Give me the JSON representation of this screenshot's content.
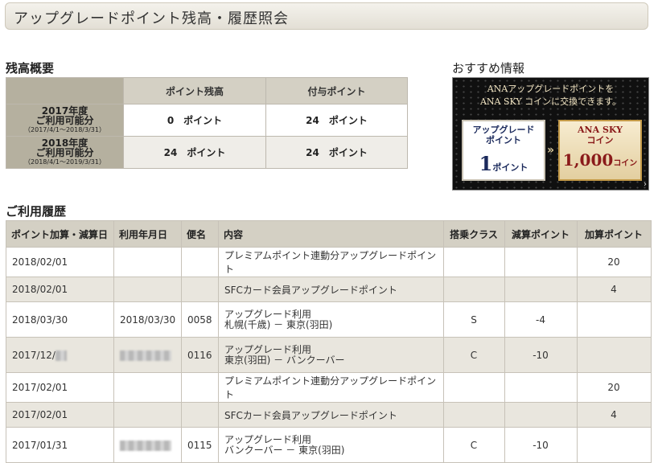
{
  "page": {
    "title": "アップグレードポイント残高・履歴照会"
  },
  "summary": {
    "heading": "残高概要",
    "columns": [
      "ポイント残高",
      "付与ポイント"
    ],
    "rows": [
      {
        "label": "2017年度",
        "label2": "ご利用可能分",
        "period": "（2017/4/1～2018/3/31）",
        "balance": "0　ポイント",
        "granted": "24　ポイント"
      },
      {
        "label": "2018年度",
        "label2": "ご利用可能分",
        "period": "（2018/4/1～2019/3/31）",
        "balance": "24　ポイント",
        "granted": "24　ポイント"
      }
    ]
  },
  "recommend": {
    "heading": "おすすめ情報",
    "banner_line1": "ANAアップグレードポイントを",
    "banner_line2": "ANA SKY コインに交換できます。",
    "from_title1": "アップグレード",
    "from_title2": "ポイント",
    "from_value": "1",
    "from_unit": "ポイント",
    "to_title1": "ANA SKY",
    "to_title2": "コイン",
    "to_value": "1,000",
    "to_unit": "コイン",
    "arrow_glyph": "»",
    "corner_arrow": "›"
  },
  "history": {
    "heading": "ご利用履歴",
    "columns": [
      "ポイント加算・減算日",
      "利用年月日",
      "便名",
      "内容",
      "搭乗クラス",
      "減算ポイント",
      "加算ポイント"
    ],
    "rows": [
      {
        "date": "2018/02/01",
        "use_date": "",
        "flight": "",
        "content": "プレミアムポイント連動分アップグレードポイント",
        "content2": "",
        "class": "",
        "minus": "",
        "plus": "20"
      },
      {
        "date": "2018/02/01",
        "use_date": "",
        "flight": "",
        "content": "SFCカード会員アップグレードポイント",
        "content2": "",
        "class": "",
        "minus": "",
        "plus": "4"
      },
      {
        "date": "2018/03/30",
        "use_date": "2018/03/30",
        "flight": "0058",
        "content": "アップグレード利用",
        "content2": "札幌(千歳) － 東京(羽田)",
        "class": "S",
        "minus": "-4",
        "plus": ""
      },
      {
        "date": "2017/12/",
        "use_date": "",
        "flight": "0116",
        "content": "アップグレード利用",
        "content2": "東京(羽田) － バンクーバー",
        "class": "C",
        "minus": "-10",
        "plus": ""
      },
      {
        "date": "2017/02/01",
        "use_date": "",
        "flight": "",
        "content": "プレミアムポイント連動分アップグレードポイント",
        "content2": "",
        "class": "",
        "minus": "",
        "plus": "20"
      },
      {
        "date": "2017/02/01",
        "use_date": "",
        "flight": "",
        "content": "SFCカード会員アップグレードポイント",
        "content2": "",
        "class": "",
        "minus": "",
        "plus": "4"
      },
      {
        "date": "2017/01/31",
        "use_date": "",
        "flight": "0115",
        "content": "アップグレード利用",
        "content2": "バンクーバー － 東京(羽田)",
        "class": "C",
        "minus": "-10",
        "plus": ""
      }
    ]
  }
}
